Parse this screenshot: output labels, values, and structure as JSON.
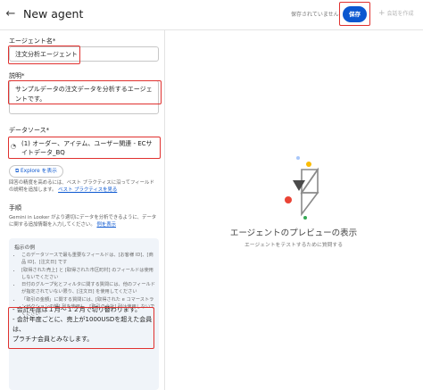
{
  "header": {
    "title": "New agent",
    "status": "保存されていません",
    "save_label": "保存",
    "create_label": "会話を作成"
  },
  "agent_name": {
    "label": "エージェント名*",
    "value": "注文分析エージェント"
  },
  "description": {
    "label": "説明*",
    "value": "サンプルデータの注文データを分析するエージェントです。"
  },
  "data_source": {
    "label": "データソース*",
    "value": "(1) オーダー、アイテム、ユーザー関連 - ECサイトデータ_BQ",
    "explore_label": "Explore を表示",
    "help_text": "回答の精度を高めるには、ベスト プラクティスに沿ってフィールドの説明を追加します。",
    "help_link": "ベスト プラクティスを見る"
  },
  "instructions": {
    "label": "手順",
    "help_text": "Gemini in Looker がより適切にデータを分析できるように、データに関する追加情報を入力してください。",
    "help_link": "例を表示",
    "example_title": "指示の例",
    "examples": [
      "このデータソースで最も重要なフィールドは、[お客様 ID]、[商品 ID]、[注文日] です",
      "[取得された売上] と [取得された市区町村] のフィールドは使用しないでください",
      "日付のグループ化とフィルタに関する質問には、他のフィールドが指定されていない限り、[注文日] を使用してください",
      "「取引の金額」に関する質問には、[取得された e コマーストランザクションの額] 列を使用し、[取引の合計] 列は使用しないでください"
    ],
    "value_lines": [
      "- 会計年度は１月〜１２月で切り替わります。",
      "- 会計年度ごとに、売上が1000USDを超えた会員は、",
      "プラチナ会員とみなします。"
    ]
  },
  "preview": {
    "title": "エージェントのプレビューの表示",
    "subtitle": "エージェントをテストするために質問する"
  }
}
